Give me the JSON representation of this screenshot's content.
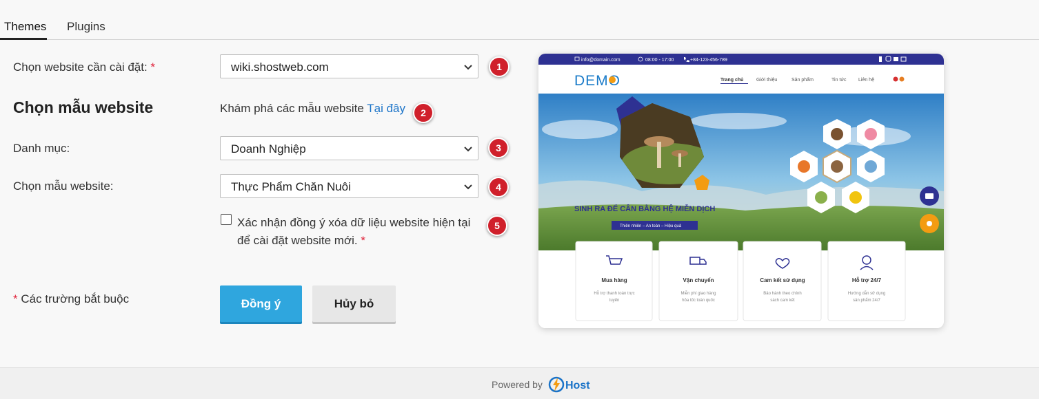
{
  "tabs": [
    {
      "label": "Themes",
      "active": true
    },
    {
      "label": "Plugins",
      "active": false
    }
  ],
  "form": {
    "website_label": "Chọn website cần cài đặt:",
    "website_value": "wiki.shostweb.com",
    "section_title": "Chọn mẫu website",
    "explore_text": "Khám phá các mẫu website",
    "explore_link": "Tại đây",
    "category_label": "Danh mục:",
    "category_value": "Doanh Nghiệp",
    "template_label": "Chọn mẫu website:",
    "template_value": "Thực Phẩm Chăn Nuôi",
    "confirm_text": "Xác nhận đồng ý xóa dữ liệu website hiện tại để cài đặt website mới.",
    "required_mark": "*",
    "required_note": "Các trường bắt buộc",
    "confirm_checked": false
  },
  "badges": [
    "1",
    "2",
    "3",
    "4",
    "5"
  ],
  "buttons": {
    "ok": "Đồng ý",
    "cancel": "Hủy bỏ"
  },
  "preview": {
    "topbar": {
      "email": "info@domain.com",
      "hours": "08:00 - 17:00",
      "phone": "+84-123-456-789"
    },
    "logo": "DEMO",
    "nav": [
      "Trang chủ",
      "Giới thiệu",
      "Sản phẩm",
      "Tin tức",
      "Liên hệ"
    ],
    "hero_title": "SINH RA ĐỂ CÂN BẰNG HỆ MIỄN DỊCH",
    "hero_tag": "Thiên nhiên – An toàn – Hiệu quả",
    "features": [
      {
        "title": "Mua hàng",
        "desc1": "Hỗ trợ thanh toán trực",
        "desc2": "tuyến"
      },
      {
        "title": "Vận chuyển",
        "desc1": "Miễn phí giao hàng",
        "desc2": "hỏa tốc toàn quốc"
      },
      {
        "title": "Cam kết sử dụng",
        "desc1": "Bảo hành theo chính",
        "desc2": "sách cam kết"
      },
      {
        "title": "Hỗ trợ 24/7",
        "desc1": "Hướng dẫn sử dụng",
        "desc2": "sản phẩm 24/7"
      }
    ]
  },
  "footer": {
    "powered": "Powered by",
    "brand": "Host"
  },
  "colors": {
    "accent": "#2fa6de",
    "badge": "#d0202b",
    "link": "#1a73c8",
    "required": "#e0223a",
    "preview_navy": "#2e3192",
    "preview_orange": "#f39c12"
  }
}
